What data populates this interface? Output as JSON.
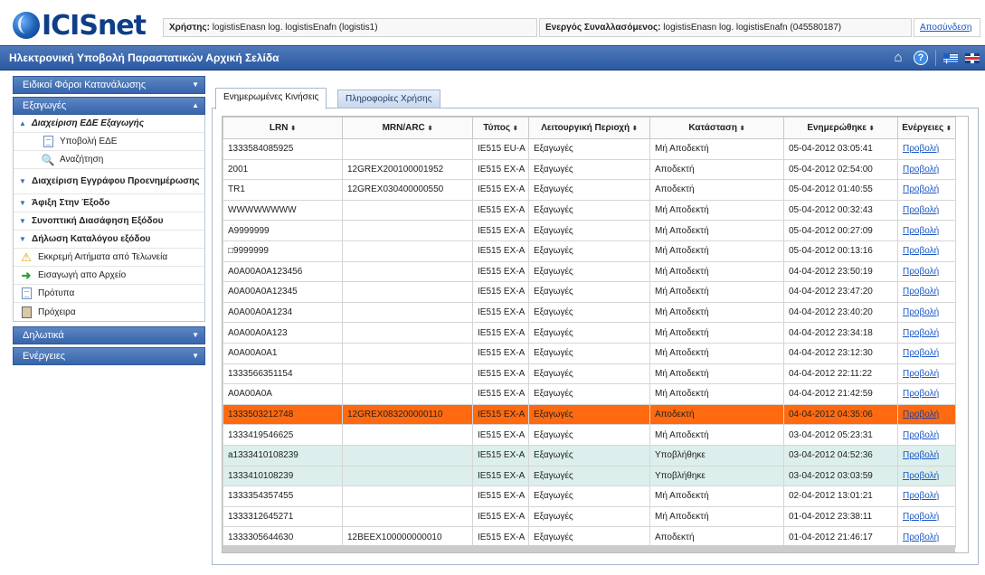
{
  "header": {
    "logo_text": "ICISnet",
    "user_label": "Χρήστης:",
    "user_value": "logistisEnasn log. logistisEnafn (logistis1)",
    "trader_label": "Ενεργός Συναλλασόμενος:",
    "trader_value": "logistisEnasn log. logistisEnafn (045580187)",
    "logout_label": "Αποσύνδεση"
  },
  "titlebar": {
    "title": "Ηλεκτρονική Υποβολή Παραστατικών Αρχική Σελίδα",
    "icons": [
      "home-icon",
      "help-icon",
      "greek-flag-icon",
      "uk-flag-icon"
    ]
  },
  "sidebar": {
    "section_excise": "Ειδικοί Φόροι Κατανάλωσης",
    "section_exports": "Εξαγωγές",
    "export_items": {
      "manage": "Διαχείριση ΕΔΕ Εξαγωγής",
      "submit": "Υποβολή ΕΔΕ",
      "search": "Αναζήτηση",
      "predoc": "Διαχείριση Εγγράφου Προενημέρωσης",
      "arrival": "Άφιξη Στην Έξοδο",
      "summary": "Συνοπτική Διασάφηση Εξόδου",
      "catalog": "Δήλωση Καταλόγου εξόδου",
      "pending": "Εκκρεμή Αιτήματα από Τελωνεία",
      "import_file": "Εισαγωγή απο Αρχείο",
      "templates": "Πρότυπα",
      "drafts": "Πρόχειρα"
    },
    "section_declarations": "Δηλωτικά",
    "section_actions": "Ενέργειες"
  },
  "tabs": {
    "updated": "Ενημερωμένες Κινήσεις",
    "usage": "Πληροφορίες Χρήσης"
  },
  "table": {
    "headers": {
      "lrn": "LRN",
      "mrn": "MRN/ARC",
      "type": "Τύπος",
      "area": "Λειτουργική Περιοχή",
      "status": "Κατάσταση",
      "updated": "Ενημερώθηκε",
      "actions": "Ενέργειες"
    },
    "sort_glyph": "⬍",
    "rows": [
      {
        "lrn": "1333584085925",
        "mrn": "",
        "type": "IE515 EU-A",
        "area": "Εξαγωγές",
        "status": "Μή Αποδεκτή",
        "updated": "05-04-2012 03:05:41",
        "action": "Προβολή",
        "style": ""
      },
      {
        "lrn": "2001",
        "mrn": "12GREX200100001952",
        "type": "IE515 EX-A",
        "area": "Εξαγωγές",
        "status": "Αποδεκτή",
        "updated": "05-04-2012 02:54:00",
        "action": "Προβολή",
        "style": ""
      },
      {
        "lrn": "TR1",
        "mrn": "12GREX030400000550",
        "type": "IE515 EX-A",
        "area": "Εξαγωγές",
        "status": "Αποδεκτή",
        "updated": "05-04-2012 01:40:55",
        "action": "Προβολή",
        "style": ""
      },
      {
        "lrn": "WWWWWWWW",
        "mrn": "",
        "type": "IE515 EX-A",
        "area": "Εξαγωγές",
        "status": "Μή Αποδεκτή",
        "updated": "05-04-2012 00:32:43",
        "action": "Προβολή",
        "style": ""
      },
      {
        "lrn": "A9999999",
        "mrn": "",
        "type": "IE515 EX-A",
        "area": "Εξαγωγές",
        "status": "Μή Αποδεκτή",
        "updated": "05-04-2012 00:27:09",
        "action": "Προβολή",
        "style": ""
      },
      {
        "lrn": "□9999999",
        "mrn": "",
        "type": "IE515 EX-A",
        "area": "Εξαγωγές",
        "status": "Μή Αποδεκτή",
        "updated": "05-04-2012 00:13:16",
        "action": "Προβολή",
        "style": ""
      },
      {
        "lrn": "A0A00A0A123456",
        "mrn": "",
        "type": "IE515 EX-A",
        "area": "Εξαγωγές",
        "status": "Μή Αποδεκτή",
        "updated": "04-04-2012 23:50:19",
        "action": "Προβολή",
        "style": ""
      },
      {
        "lrn": "A0A00A0A12345",
        "mrn": "",
        "type": "IE515 EX-A",
        "area": "Εξαγωγές",
        "status": "Μή Αποδεκτή",
        "updated": "04-04-2012 23:47:20",
        "action": "Προβολή",
        "style": ""
      },
      {
        "lrn": "A0A00A0A1234",
        "mrn": "",
        "type": "IE515 EX-A",
        "area": "Εξαγωγές",
        "status": "Μή Αποδεκτή",
        "updated": "04-04-2012 23:40:20",
        "action": "Προβολή",
        "style": ""
      },
      {
        "lrn": "A0A00A0A123",
        "mrn": "",
        "type": "IE515 EX-A",
        "area": "Εξαγωγές",
        "status": "Μή Αποδεκτή",
        "updated": "04-04-2012 23:34:18",
        "action": "Προβολή",
        "style": ""
      },
      {
        "lrn": "A0A00A0A1",
        "mrn": "",
        "type": "IE515 EX-A",
        "area": "Εξαγωγές",
        "status": "Μή Αποδεκτή",
        "updated": "04-04-2012 23:12:30",
        "action": "Προβολή",
        "style": ""
      },
      {
        "lrn": "1333566351154",
        "mrn": "",
        "type": "IE515 EX-A",
        "area": "Εξαγωγές",
        "status": "Μή Αποδεκτή",
        "updated": "04-04-2012 22:11:22",
        "action": "Προβολή",
        "style": ""
      },
      {
        "lrn": "A0A00A0A",
        "mrn": "",
        "type": "IE515 EX-A",
        "area": "Εξαγωγές",
        "status": "Μή Αποδεκτή",
        "updated": "04-04-2012 21:42:59",
        "action": "Προβολή",
        "style": ""
      },
      {
        "lrn": "1333503212748",
        "mrn": "12GREX083200000110",
        "type": "IE515 EX-A",
        "area": "Εξαγωγές",
        "status": "Αποδεκτή",
        "updated": "04-04-2012 04:35:06",
        "action": "Προβολή",
        "style": "orange"
      },
      {
        "lrn": "1333419546625",
        "mrn": "",
        "type": "IE515 EX-A",
        "area": "Εξαγωγές",
        "status": "Μή Αποδεκτή",
        "updated": "03-04-2012 05:23:31",
        "action": "Προβολή",
        "style": ""
      },
      {
        "lrn": "a1333410108239",
        "mrn": "",
        "type": "IE515 EX-A",
        "area": "Εξαγωγές",
        "status": "Υποβλήθηκε",
        "updated": "03-04-2012 04:52:36",
        "action": "Προβολή",
        "style": "mint"
      },
      {
        "lrn": "1333410108239",
        "mrn": "",
        "type": "IE515 EX-A",
        "area": "Εξαγωγές",
        "status": "Υποβλήθηκε",
        "updated": "03-04-2012 03:03:59",
        "action": "Προβολή",
        "style": "mint"
      },
      {
        "lrn": "1333354357455",
        "mrn": "",
        "type": "IE515 EX-A",
        "area": "Εξαγωγές",
        "status": "Μή Αποδεκτή",
        "updated": "02-04-2012 13:01:21",
        "action": "Προβολή",
        "style": ""
      },
      {
        "lrn": "1333312645271",
        "mrn": "",
        "type": "IE515 EX-A",
        "area": "Εξαγωγές",
        "status": "Μή Αποδεκτή",
        "updated": "01-04-2012 23:38:11",
        "action": "Προβολή",
        "style": ""
      },
      {
        "lrn": "1333305644630",
        "mrn": "12BEEX100000000010",
        "type": "IE515 EX-A",
        "area": "Εξαγωγές",
        "status": "Αποδεκτή",
        "updated": "01-04-2012 21:46:17",
        "action": "Προβολή",
        "style": ""
      }
    ]
  },
  "colors": {
    "header_blue": "#2b5aa3",
    "highlight_orange": "#ff6a10",
    "highlight_mint": "#dcefec",
    "link_blue": "#1a56c4"
  }
}
